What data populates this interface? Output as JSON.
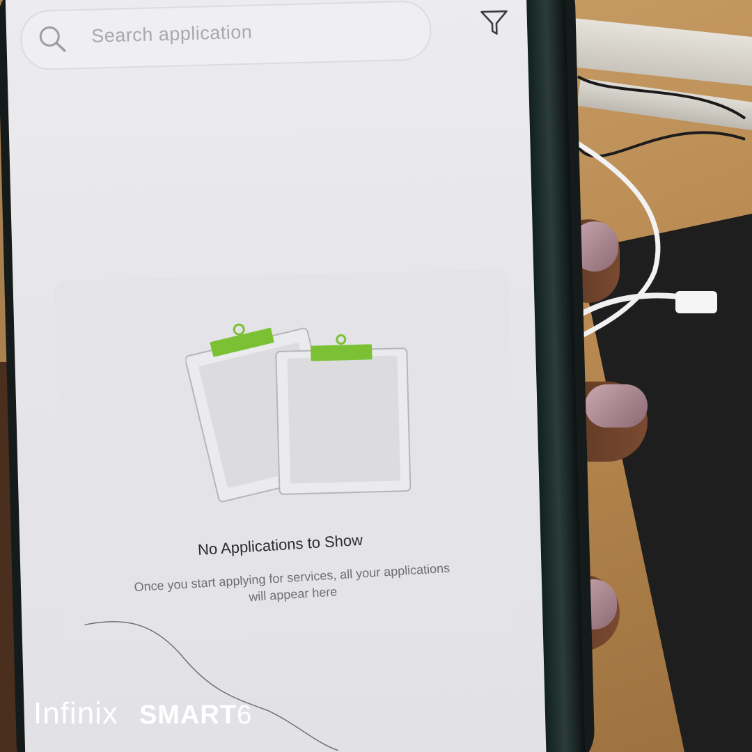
{
  "search": {
    "placeholder": "Search application",
    "icon": "search-icon"
  },
  "filter": {
    "icon": "filter-icon"
  },
  "empty_state": {
    "title": "No Applications to Show",
    "description_line1": "Once you start applying for services, all your applications",
    "description_line2": "will appear here",
    "illustration": "clipboards-icon",
    "accent_color": "#7cc034"
  },
  "watermark": {
    "brand": "Infinix",
    "model": "SMART",
    "model_number": "6"
  }
}
